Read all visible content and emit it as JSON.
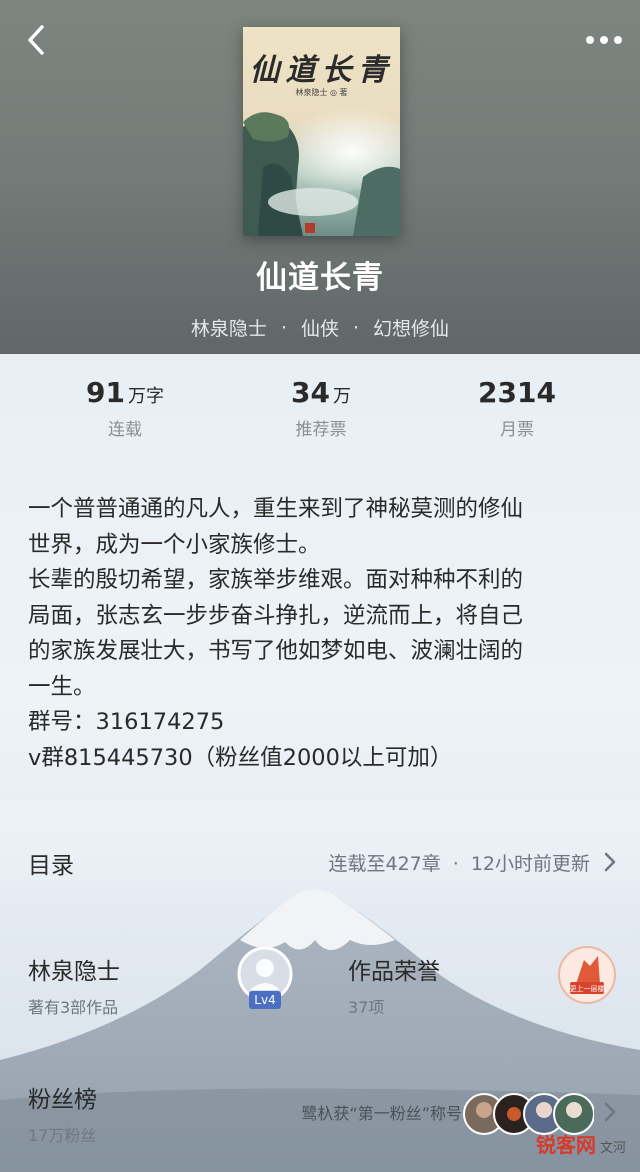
{
  "header": {
    "back_icon": "chevron-left-icon",
    "more_icon": "more-dots-icon"
  },
  "cover": {
    "title": "仙道长青",
    "author_line": "林泉隐士 ◎ 著"
  },
  "book": {
    "title": "仙道长青",
    "author": "林泉隐士",
    "category": "仙侠",
    "subcategory": "幻想修仙",
    "separator": "·"
  },
  "stats": [
    {
      "value": "91",
      "unit": "万字",
      "label": "连载"
    },
    {
      "value": "34",
      "unit": "万",
      "label": "推荐票"
    },
    {
      "value": "2314",
      "unit": "",
      "label": "月票"
    }
  ],
  "description": {
    "line1": "一个普普通通的凡人，重生来到了神秘莫测的修仙",
    "line2": "世界，成为一个小家族修士。",
    "line3": "长辈的殷切希望，家族举步维艰。面对种种不利的",
    "line4": "局面，张志玄一步步奋斗挣扎，逆流而上，将自己",
    "line5": "的家族发展壮大，书写了他如梦如电、波澜壮阔的",
    "line6": "一生。",
    "line7": "群号：316174275",
    "line8": "v群815445730（粉丝值2000以上可加）"
  },
  "toc": {
    "title": "目录",
    "status": "连载至427章",
    "separator": "·",
    "updated": "12小时前更新"
  },
  "author_card": {
    "name": "林泉隐士",
    "works": "著有3部作品",
    "level": "Lv4"
  },
  "honor_card": {
    "title": "作品荣誉",
    "count": "37项",
    "badge_text": "更上一层楼"
  },
  "fans": {
    "title": "粉丝榜",
    "count": "17万粉丝",
    "note": "鹭杁获“第一粉丝”称号"
  },
  "watermark": {
    "brand": "锐客网",
    "extra": "文河"
  },
  "colors": {
    "header_bg": "#737b78",
    "level_badge": "#4a6fc4",
    "honor_badge": "#e05a3a",
    "watermark": "#d63a2c"
  }
}
